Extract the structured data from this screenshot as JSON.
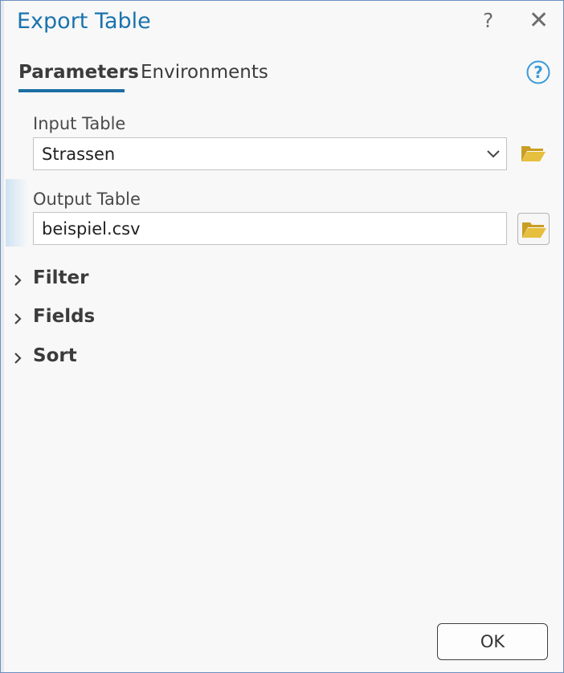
{
  "window": {
    "title": "Export Table",
    "help_glyph": "?",
    "close_glyph": "✕"
  },
  "tabs": [
    {
      "label": "Parameters",
      "active": true
    },
    {
      "label": "Environments",
      "active": false
    }
  ],
  "params": {
    "input_table": {
      "label": "Input Table",
      "value": "Strassen"
    },
    "output_table": {
      "label": "Output Table",
      "value": "beispiel.csv"
    }
  },
  "sections": [
    {
      "label": "Filter"
    },
    {
      "label": "Fields"
    },
    {
      "label": "Sort"
    }
  ],
  "footer": {
    "ok_label": "OK"
  },
  "icons": {
    "help": "question-circle-icon",
    "folder": "folder-open-icon",
    "dropdown": "chevron-down-icon",
    "expand": "chevron-right-icon"
  },
  "colors": {
    "accent": "#1d6ea4",
    "title": "#1a73ad",
    "folder": "#e3b930"
  }
}
